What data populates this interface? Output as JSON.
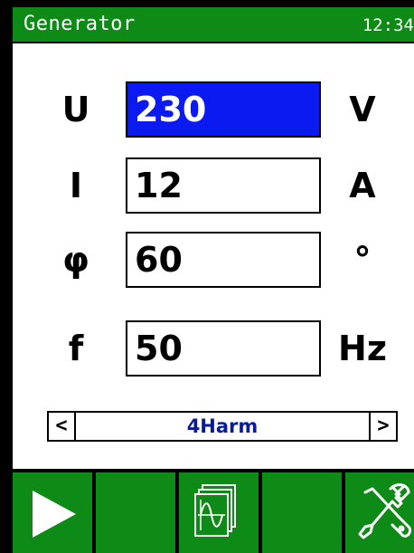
{
  "header": {
    "title": "Generator",
    "clock": "12:34"
  },
  "parameters": [
    {
      "symbol": "U",
      "value": "230",
      "unit": "V",
      "selected": true
    },
    {
      "symbol": "I",
      "value": "12",
      "unit": "A",
      "selected": false
    },
    {
      "symbol": "φ",
      "value": "60",
      "unit": "°",
      "selected": false
    },
    {
      "symbol": "f",
      "value": "50",
      "unit": "Hz",
      "selected": false
    }
  ],
  "waveform_selector": {
    "prev_label": "<",
    "value": "4Harm",
    "next_label": ">"
  },
  "softkeys": [
    {
      "icon": "play-icon"
    },
    {
      "icon": ""
    },
    {
      "icon": "waveform-pages-icon"
    },
    {
      "icon": ""
    },
    {
      "icon": "tools-icon"
    }
  ],
  "colors": {
    "bar": "#0e8a17",
    "highlight": "#0a1af0",
    "selector_text": "#0a1a9a"
  }
}
